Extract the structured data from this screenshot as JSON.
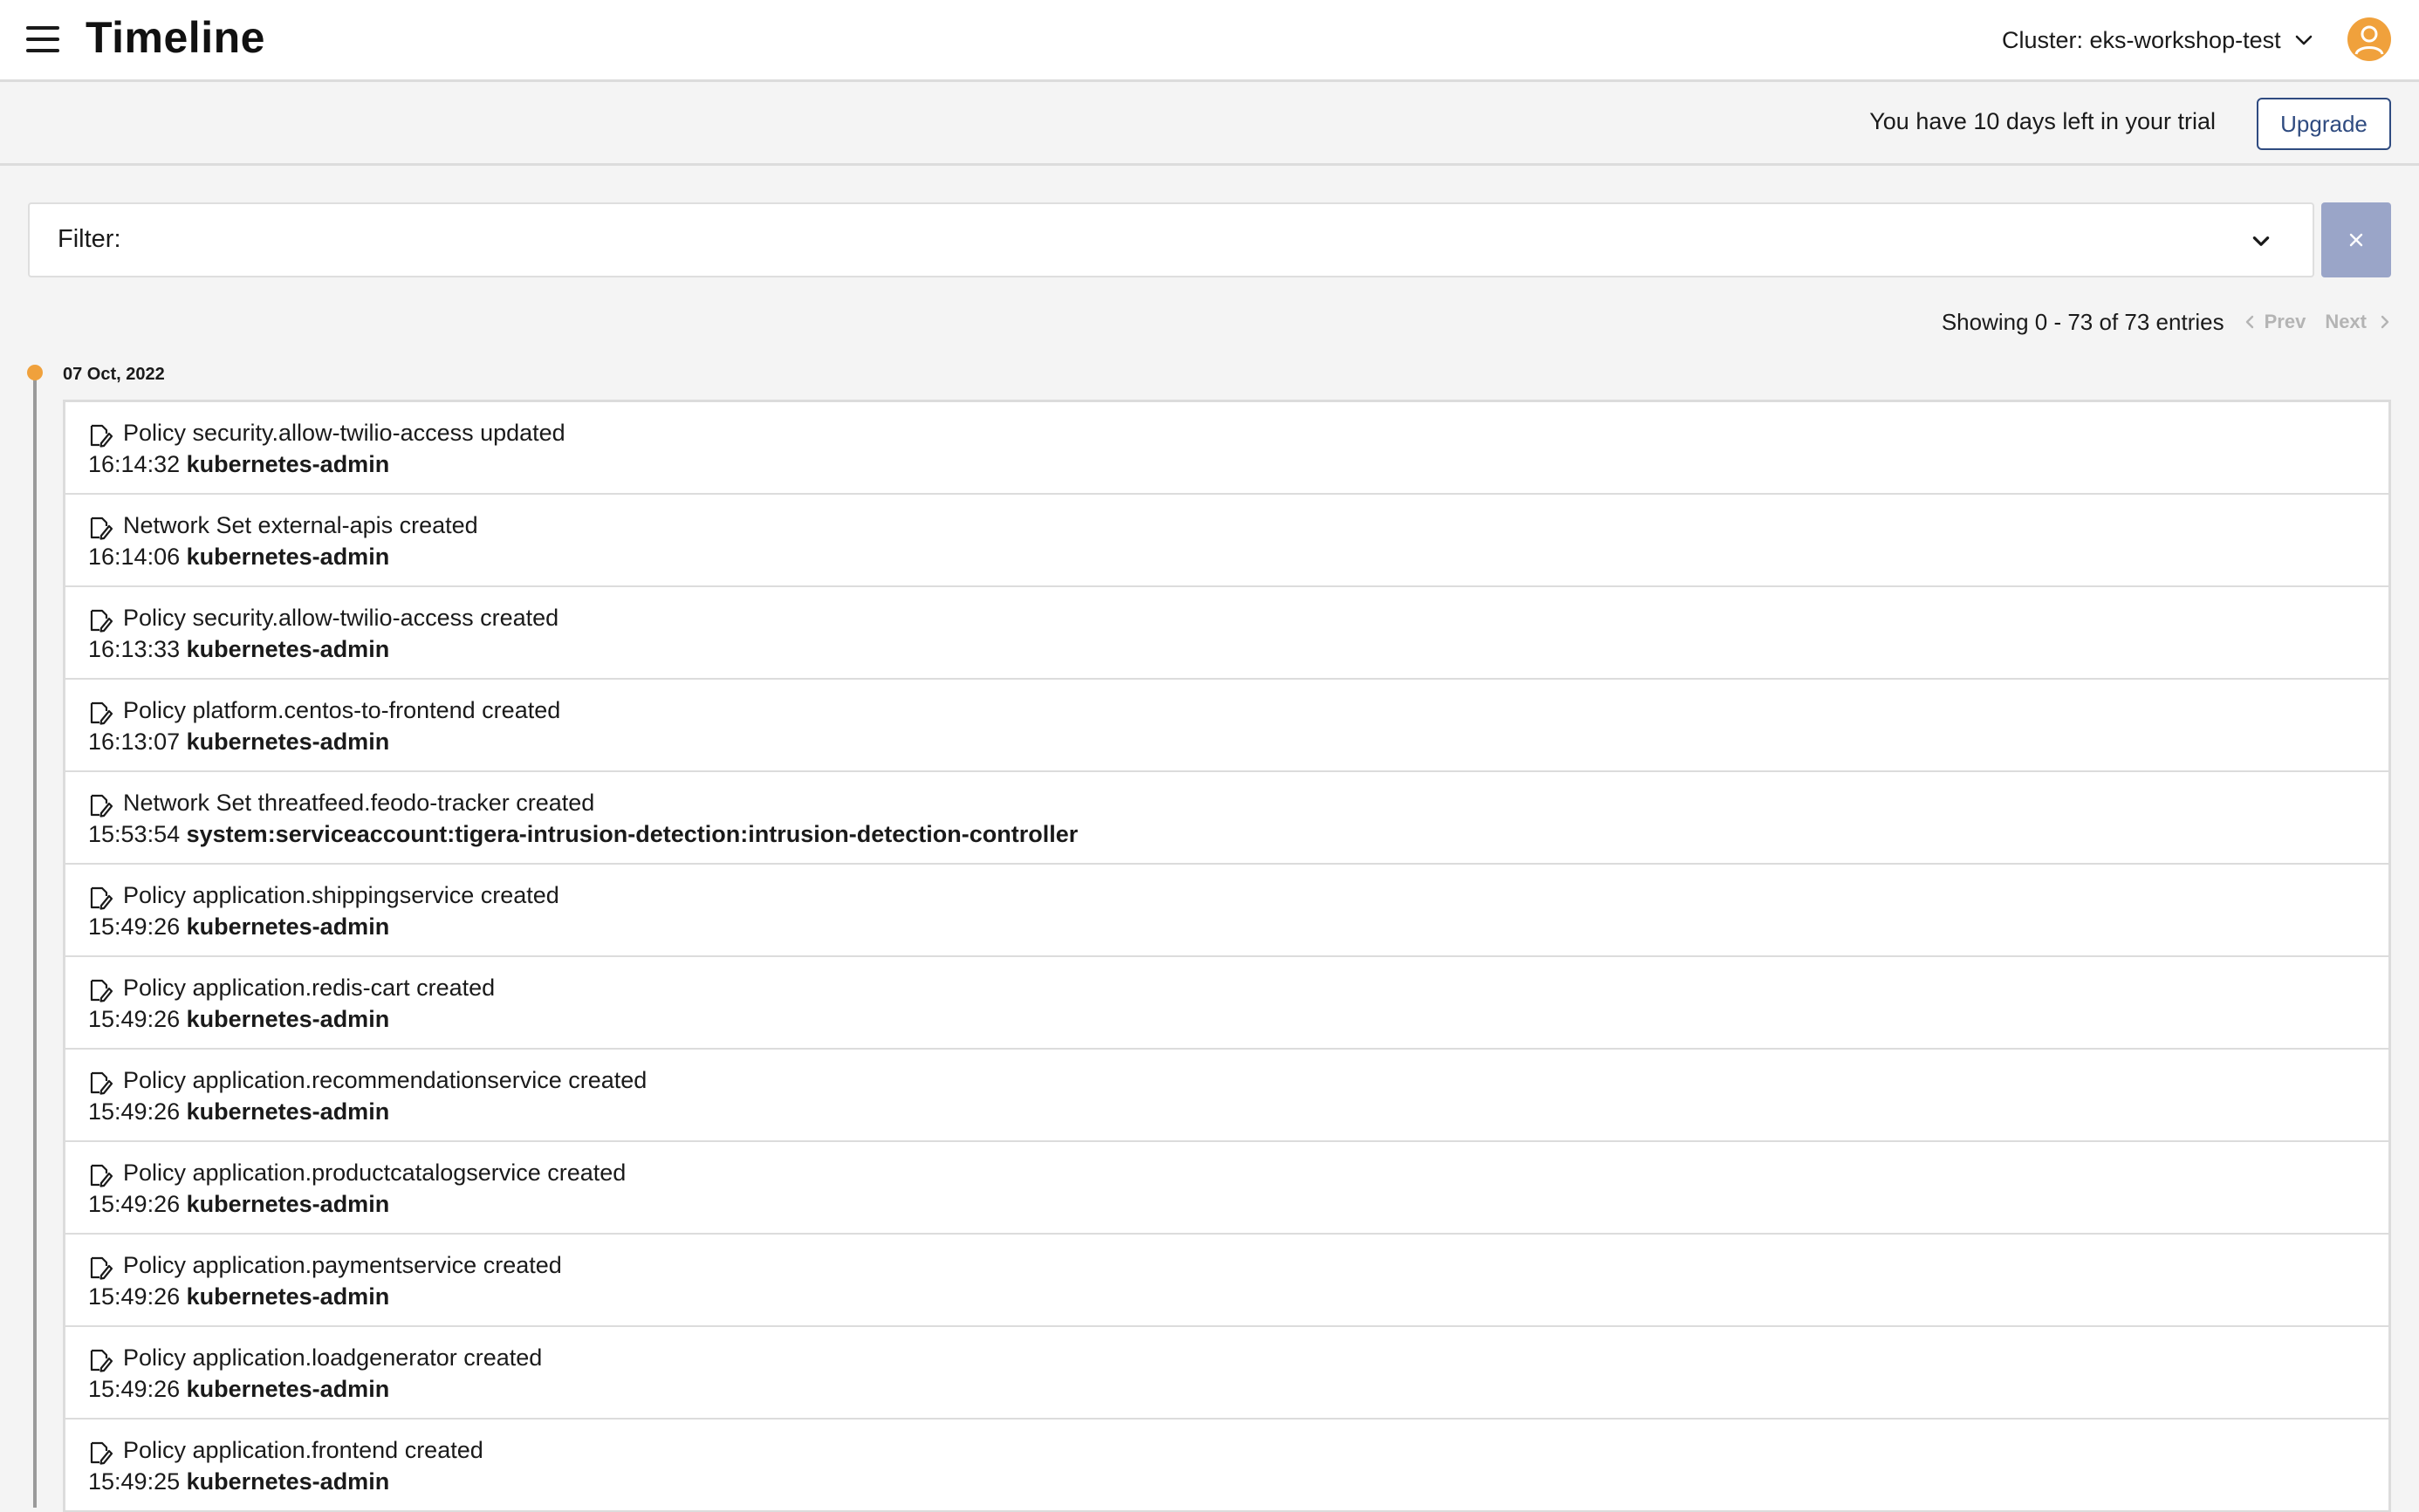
{
  "header": {
    "title": "Timeline",
    "cluster_label": "Cluster: eks-workshop-test"
  },
  "trial": {
    "message": "You have 10 days left in your trial",
    "upgrade_label": "Upgrade"
  },
  "filter": {
    "label": "Filter:"
  },
  "pagination": {
    "summary": "Showing 0 - 73 of 73 entries",
    "prev_label": "Prev",
    "next_label": "Next"
  },
  "timeline": {
    "accent_color": "#f0a13c",
    "date": "07 Oct, 2022",
    "events": [
      {
        "title": "Policy security.allow-twilio-access updated",
        "time": "16:14:32",
        "user": "kubernetes-admin"
      },
      {
        "title": "Network Set external-apis created",
        "time": "16:14:06",
        "user": "kubernetes-admin"
      },
      {
        "title": "Policy security.allow-twilio-access created",
        "time": "16:13:33",
        "user": "kubernetes-admin"
      },
      {
        "title": "Policy platform.centos-to-frontend created",
        "time": "16:13:07",
        "user": "kubernetes-admin"
      },
      {
        "title": "Network Set threatfeed.feodo-tracker created",
        "time": "15:53:54",
        "user": "system:serviceaccount:tigera-intrusion-detection:intrusion-detection-controller"
      },
      {
        "title": "Policy application.shippingservice created",
        "time": "15:49:26",
        "user": "kubernetes-admin"
      },
      {
        "title": "Policy application.redis-cart created",
        "time": "15:49:26",
        "user": "kubernetes-admin"
      },
      {
        "title": "Policy application.recommendationservice created",
        "time": "15:49:26",
        "user": "kubernetes-admin"
      },
      {
        "title": "Policy application.productcatalogservice created",
        "time": "15:49:26",
        "user": "kubernetes-admin"
      },
      {
        "title": "Policy application.paymentservice created",
        "time": "15:49:26",
        "user": "kubernetes-admin"
      },
      {
        "title": "Policy application.loadgenerator created",
        "time": "15:49:26",
        "user": "kubernetes-admin"
      },
      {
        "title": "Policy application.frontend created",
        "time": "15:49:25",
        "user": "kubernetes-admin"
      }
    ]
  },
  "icons": {
    "menu": "hamburger-menu-icon",
    "cluster_dropdown": "chevron-down-icon",
    "avatar": "user-avatar-icon",
    "filter_dropdown": "chevron-down-icon",
    "clear": "close-icon",
    "prev": "chevron-left-icon",
    "next": "chevron-right-icon",
    "event": "edit-document-icon"
  }
}
